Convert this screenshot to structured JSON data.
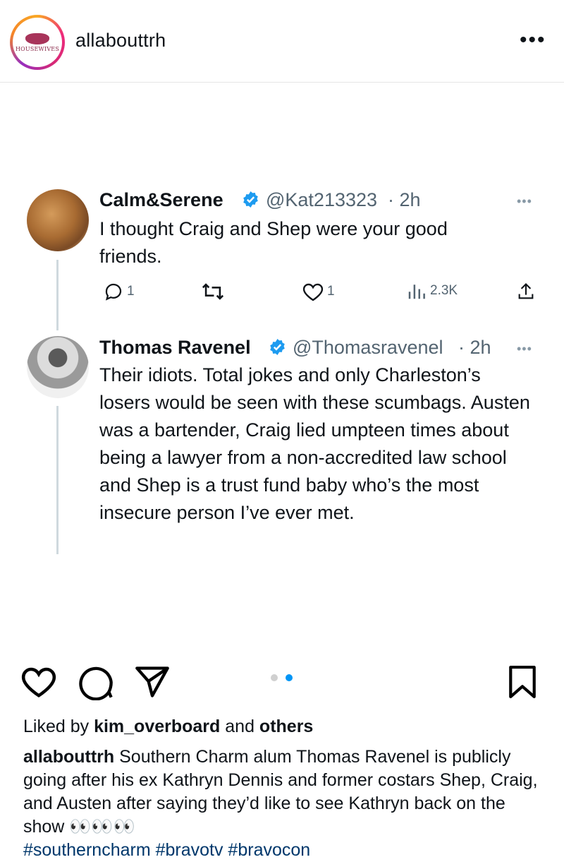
{
  "header": {
    "username": "allabouttrh",
    "avatar_logo_text": "HOUSEWIVES"
  },
  "tweet1": {
    "name": "Calm&Serene",
    "handle": "@Kat213323",
    "time": "· 2h",
    "text": "I thought Craig and Shep were your good friends.",
    "replies": "1",
    "likes": "1",
    "views": "2.3K"
  },
  "tweet2": {
    "name": "Thomas Ravenel",
    "handle": "@Thomasravenel",
    "time": "· 2h",
    "text": "Their idiots.  Total jokes and only Charleston’s losers would be seen with these scumbags.  Austen was a bartender, Craig lied umpteen times about being a lawyer from a non-accredited law school and Shep is a trust fund baby who’s the most insecure person I’ve ever met."
  },
  "post": {
    "liked_prefix": "Liked by ",
    "liked_user": "kim_overboard",
    "liked_mid": " and ",
    "liked_others": "others",
    "caption_user": "allabouttrh",
    "caption_text": " Southern Charm alum Thomas Ravenel is publicly going after his ex Kathryn Dennis and former costars Shep, Craig, and Austen after saying they’d like to see Kathryn back on the show 👀👀👀",
    "hashtags": "#southerncharm #bravotv #bravocon"
  },
  "colors": {
    "verified": "#1d9bf0",
    "hashtag": "#00376b",
    "active_dot": "#0095f6"
  }
}
